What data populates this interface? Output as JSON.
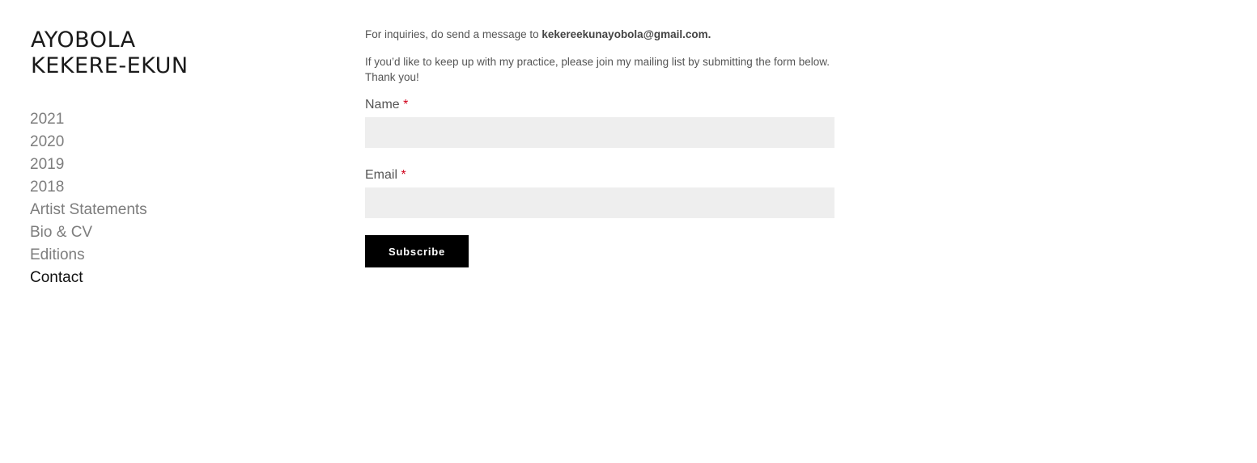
{
  "site": {
    "logo_line1": "AYOBOLA",
    "logo_line2": "KEKERE-EKUN"
  },
  "nav": {
    "items": [
      {
        "label": "2021",
        "active": false
      },
      {
        "label": "2020",
        "active": false
      },
      {
        "label": "2019",
        "active": false
      },
      {
        "label": "2018",
        "active": false
      },
      {
        "label": "Artist Statements",
        "active": false
      },
      {
        "label": "Bio & CV",
        "active": false
      },
      {
        "label": "Editions",
        "active": false
      },
      {
        "label": "Contact",
        "active": true
      }
    ]
  },
  "contact": {
    "inquiry_prefix": "For inquiries, do send a message to ",
    "email": "kekereekunayobola@gmail.com.",
    "mailing_line1": "If you’d like to keep up with my practice, please join my mailing list by submitting the form below.",
    "mailing_line2": "Thank you!"
  },
  "form": {
    "name_label": "Name",
    "email_label": "Email",
    "required_mark": "*",
    "name_value": "",
    "email_value": "",
    "subscribe_label": "Subscribe"
  },
  "colors": {
    "required": "#d0021b",
    "input_bg": "#eeeeee",
    "button_bg": "#000000",
    "nav_inactive": "#7d7d7d",
    "nav_active": "#111111"
  }
}
